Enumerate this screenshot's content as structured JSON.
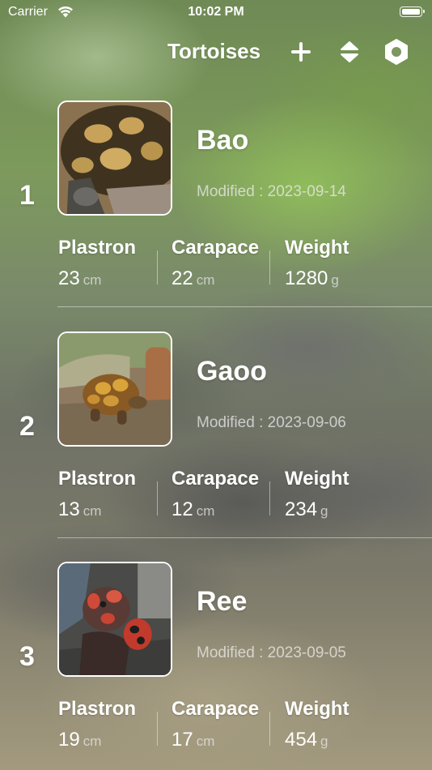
{
  "status_bar": {
    "carrier": "Carrier",
    "time": "10:02 PM"
  },
  "nav": {
    "title": "Tortoises",
    "add_icon": "plus-icon",
    "sort_icon": "sort-icon",
    "settings_icon": "gear-icon"
  },
  "labels": {
    "plastron": "Plastron",
    "carapace": "Carapace",
    "weight": "Weight"
  },
  "tortoises": [
    {
      "index": "1",
      "name": "Bao",
      "modified": "Modified : 2023-09-14",
      "plastron": "23",
      "plastron_unit": "cm",
      "carapace": "22",
      "carapace_unit": "cm",
      "weight": "1280",
      "weight_unit": "g"
    },
    {
      "index": "2",
      "name": "Gaoo",
      "modified": "Modified : 2023-09-06",
      "plastron": "13",
      "plastron_unit": "cm",
      "carapace": "12",
      "carapace_unit": "cm",
      "weight": "234",
      "weight_unit": "g"
    },
    {
      "index": "3",
      "name": "Ree",
      "modified": "Modified : 2023-09-05",
      "plastron": "19",
      "plastron_unit": "cm",
      "carapace": "17",
      "carapace_unit": "cm",
      "weight": "454",
      "weight_unit": "g"
    }
  ]
}
